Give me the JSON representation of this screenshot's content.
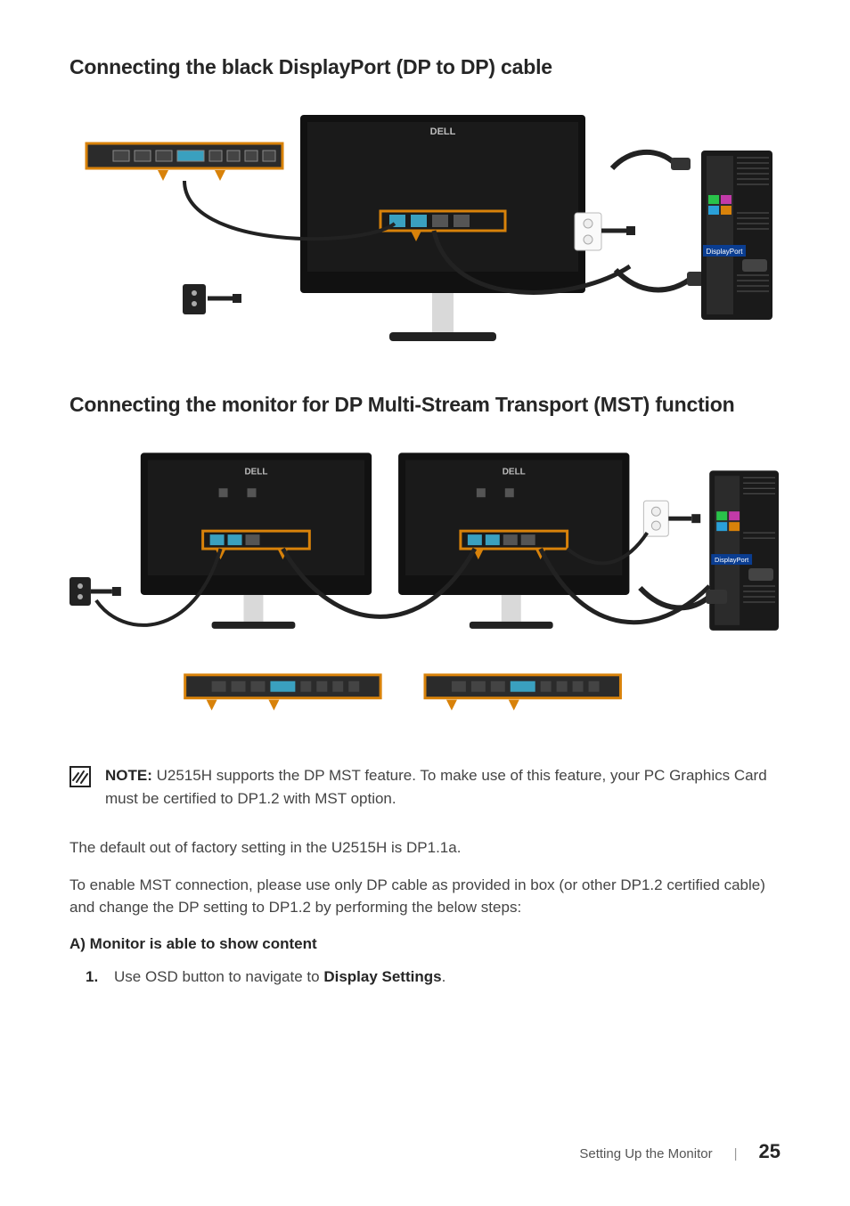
{
  "headings": {
    "h1": "Connecting the black DisplayPort (DP to DP) cable",
    "h2": "Connecting the monitor for DP Multi-Stream Transport (MST) function"
  },
  "note": {
    "label": "NOTE:",
    "text": " U2515H supports the DP MST feature. To make use of this feature, your PC Graphics Card must be certified to DP1.2 with MST option."
  },
  "paragraphs": {
    "p1": "The default out of factory setting in the U2515H is DP1.1a.",
    "p2": "To enable MST connection, please use only DP cable as provided in box (or other DP1.2 certified cable) and change the DP setting to DP1.2 by performing the below steps:"
  },
  "subheading": "A) Monitor is able to show content",
  "step1": {
    "num": "1.",
    "pre": "Use OSD button to navigate to ",
    "bold": "Display Settings",
    "post": "."
  },
  "diagram_labels": {
    "brand": "DELL",
    "dp_port": "DisplayPort"
  },
  "footer": {
    "section": "Setting Up the Monitor",
    "sep": "|",
    "page": "25"
  }
}
